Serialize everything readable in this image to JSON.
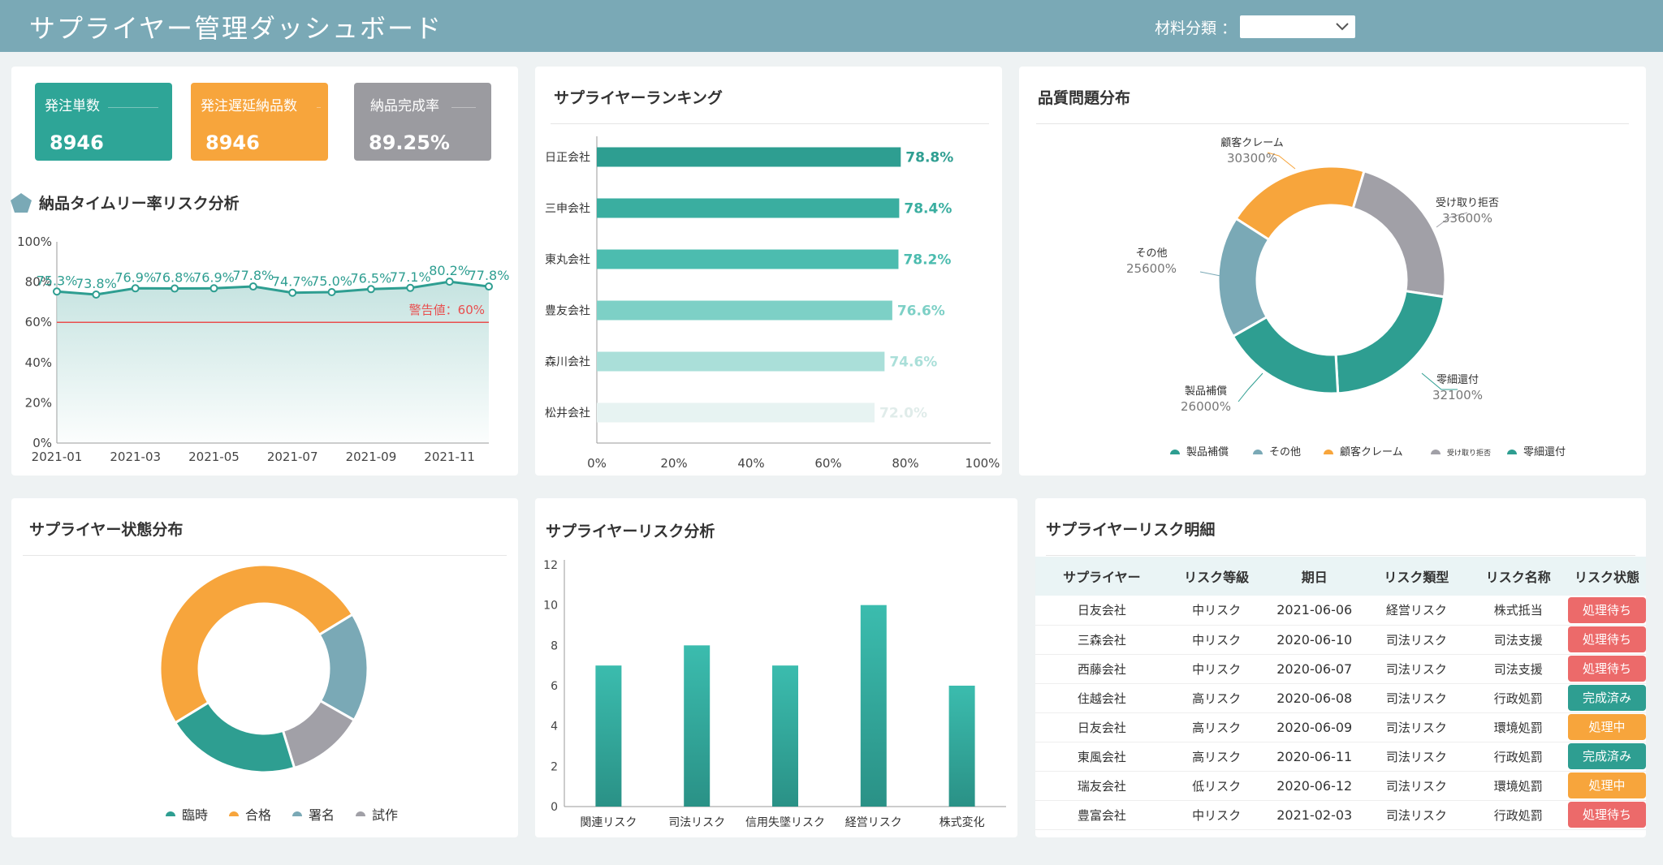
{
  "header": {
    "title": "サプライヤー管理ダッシュボード",
    "filter_label": "材料分類 ："
  },
  "kpis": [
    {
      "label": "発注単数",
      "value": "8946",
      "color": "#2ea597"
    },
    {
      "label": "発注遅延納品数",
      "value": "8946",
      "color": "#f7a53c"
    },
    {
      "label": "納品完成率",
      "value": "89.25%",
      "color": "#9b9ba0"
    }
  ],
  "colors": {
    "teal": "#2e9e91",
    "orange": "#f7a53c",
    "gray": "#a1a0a7",
    "blue": "#7aa9b6",
    "red": "#e94e4e"
  },
  "titles": {
    "timely": "納品タイムリー率リスク分析",
    "ranking": "サプライヤーランキング",
    "quality": "品質問題分布",
    "status": "サプライヤー状態分布",
    "risk_analysis": "サプライヤーリスク分析",
    "risk_detail": "サプライヤーリスク明細"
  },
  "chart_data": [
    {
      "id": "timely",
      "type": "line",
      "x": [
        "2021-01",
        "2021-02",
        "2021-03",
        "2021-04",
        "2021-05",
        "2021-06",
        "2021-07",
        "2021-08",
        "2021-09",
        "2021-10",
        "2021-11",
        "2021-12"
      ],
      "x_ticks": [
        "2021-01",
        "2021-03",
        "2021-05",
        "2021-07",
        "2021-09",
        "2021-11"
      ],
      "values": [
        75.3,
        73.8,
        76.9,
        76.8,
        76.9,
        77.8,
        74.7,
        75.0,
        76.5,
        77.1,
        80.2,
        77.8
      ],
      "labels": [
        "75.3%",
        "73.8%",
        "76.9%",
        "76.8%",
        "76.9%",
        "77.8%",
        "74.7%",
        "75.0%",
        "76.5%",
        "77.1%",
        "80.2%",
        "77.8%"
      ],
      "ylim": [
        0,
        100
      ],
      "y_ticks": [
        "0%",
        "20%",
        "40%",
        "60%",
        "80%",
        "100%"
      ],
      "threshold": 60,
      "threshold_label": "警告値：60%"
    },
    {
      "id": "ranking",
      "type": "bar",
      "orientation": "horizontal",
      "categories": [
        "日正会社",
        "三申会社",
        "東丸会社",
        "豊友会社",
        "森川会社",
        "松井会社"
      ],
      "values": [
        78.8,
        78.4,
        78.2,
        76.6,
        74.6,
        72.0
      ],
      "labels": [
        "78.8%",
        "78.4%",
        "78.2%",
        "76.6%",
        "74.6%",
        "72.0%"
      ],
      "colors": [
        "#2e9e91",
        "#3aaea0",
        "#4cbcaf",
        "#7dd0c6",
        "#aadfd9",
        "#e7f3f2"
      ],
      "xlim": [
        0,
        100
      ],
      "x_ticks": [
        "0%",
        "20%",
        "40%",
        "60%",
        "80%",
        "100%"
      ]
    },
    {
      "id": "quality",
      "type": "pie",
      "slices": [
        {
          "name": "顧客クレーム",
          "value": 30300,
          "label": "30300%",
          "color": "#f7a53c"
        },
        {
          "name": "受け取り拒否",
          "value": 33600,
          "label": "33600%",
          "color": "#a1a0a7"
        },
        {
          "name": "零細還付",
          "value": 32100,
          "label": "32100%",
          "color": "#2e9e91"
        },
        {
          "name": "製品補償",
          "value": 26000,
          "label": "26000%",
          "color": "#2e9e91"
        },
        {
          "name": "その他",
          "value": 25600,
          "label": "25600%",
          "color": "#7aa9b6"
        }
      ],
      "legend": [
        "製品補償",
        "その他",
        "顧客クレーム",
        "受け取り拒否",
        "零細還付"
      ]
    },
    {
      "id": "status",
      "type": "pie",
      "slices": [
        {
          "name": "合格",
          "value": 50,
          "color": "#f7a53c"
        },
        {
          "name": "署名",
          "value": 17,
          "color": "#7aa9b6"
        },
        {
          "name": "試作",
          "value": 12,
          "color": "#a1a0a7"
        },
        {
          "name": "臨時",
          "value": 21,
          "color": "#2e9e91"
        }
      ],
      "legend": [
        "臨時",
        "合格",
        "署名",
        "試作"
      ]
    },
    {
      "id": "risk_analysis",
      "type": "bar",
      "categories": [
        "関連リスク",
        "司法リスク",
        "信用失墜リスク",
        "経営リスク",
        "株式変化"
      ],
      "values": [
        7,
        8,
        7,
        10,
        6
      ],
      "ylim": [
        0,
        12
      ],
      "y_ticks": [
        "0",
        "2",
        "4",
        "6",
        "8",
        "10",
        "12"
      ]
    }
  ],
  "table": {
    "headers": [
      "サプライヤー",
      "リスク等級",
      "期日",
      "リスク類型",
      "リスク名称",
      "リスク状態"
    ],
    "rows": [
      [
        "日友会社",
        "中リスク",
        "2021-06-06",
        "経営リスク",
        "株式抵当",
        "処理待ち"
      ],
      [
        "三森会社",
        "中リスク",
        "2020-06-10",
        "司法リスク",
        "司法支援",
        "処理待ち"
      ],
      [
        "西藤会社",
        "中リスク",
        "2020-06-07",
        "司法リスク",
        "司法支援",
        "処理待ち"
      ],
      [
        "住越会社",
        "高リスク",
        "2020-06-08",
        "司法リスク",
        "行政処罰",
        "完成済み"
      ],
      [
        "日友会社",
        "高リスク",
        "2020-06-09",
        "司法リスク",
        "環境処罰",
        "処理中"
      ],
      [
        "東風会社",
        "高リスク",
        "2020-06-11",
        "司法リスク",
        "行政処罰",
        "完成済み"
      ],
      [
        "瑞友会社",
        "低リスク",
        "2020-06-12",
        "司法リスク",
        "環境処罰",
        "処理中"
      ],
      [
        "豊富会社",
        "中リスク",
        "2021-02-03",
        "司法リスク",
        "行政処罰",
        "処理待ち"
      ]
    ],
    "status_colors": {
      "処理待ち": "#ec6a6a",
      "完成済み": "#2e9e91",
      "処理中": "#f7a53c"
    }
  }
}
